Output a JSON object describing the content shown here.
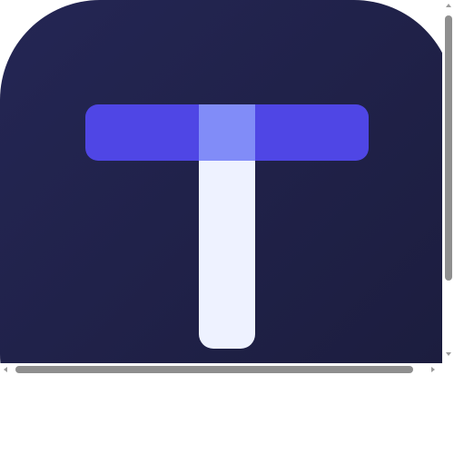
{
  "image": {
    "icon": "letter-t-logo-icon",
    "colors": {
      "background_start": "#242654",
      "background_end": "#1b1c3c",
      "crossbar": "#4f46e5",
      "crossbar_highlight": "#818cf8",
      "stem": "#eef2ff"
    }
  },
  "scrollbars": {
    "vertical_thumb_icon": "scrollbar-thumb",
    "horizontal_thumb_icon": "scrollbar-thumb",
    "colors": {
      "thumb": "#8f8f8f",
      "arrow": "#9a9a9a"
    }
  }
}
